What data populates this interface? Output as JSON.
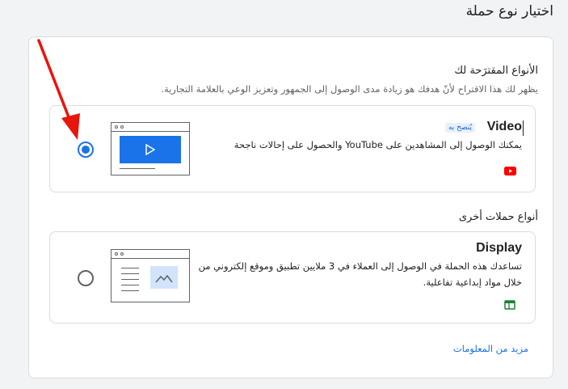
{
  "page": {
    "title": "اختيار نوع حملة"
  },
  "recommended": {
    "heading": "الأنواع المقترَحة لك",
    "description": "يظهر لك هذا الاقتراح لأنّ هدفك هو زيادة مدى الوصول إلى الجمهور وتعزيز الوعي بالعلامة التجارية."
  },
  "video_card": {
    "title": "Video",
    "badge": "يُنصح به",
    "description": "يمكنك الوصول إلى المشاهدين على YouTube والحصول على إحالات ناجحة",
    "selected": true,
    "icon": "youtube-icon",
    "icon_color": "#ff0000"
  },
  "other": {
    "heading": "أنواع حملات أخرى"
  },
  "display_card": {
    "title": "Display",
    "description_line1": "تساعدك هذه الحملة في الوصول إلى العملاء في 3 ملايين تطبيق وموقع إلكتروني من",
    "description_line2": "خلال مواد إبداعية تفاعلية.",
    "selected": false,
    "icon": "display-icon",
    "icon_color": "#188038"
  },
  "more_info": {
    "label": "مزيد من المعلومات"
  },
  "colors": {
    "accent": "#1a73e8",
    "annotation_arrow": "#e8150c"
  }
}
